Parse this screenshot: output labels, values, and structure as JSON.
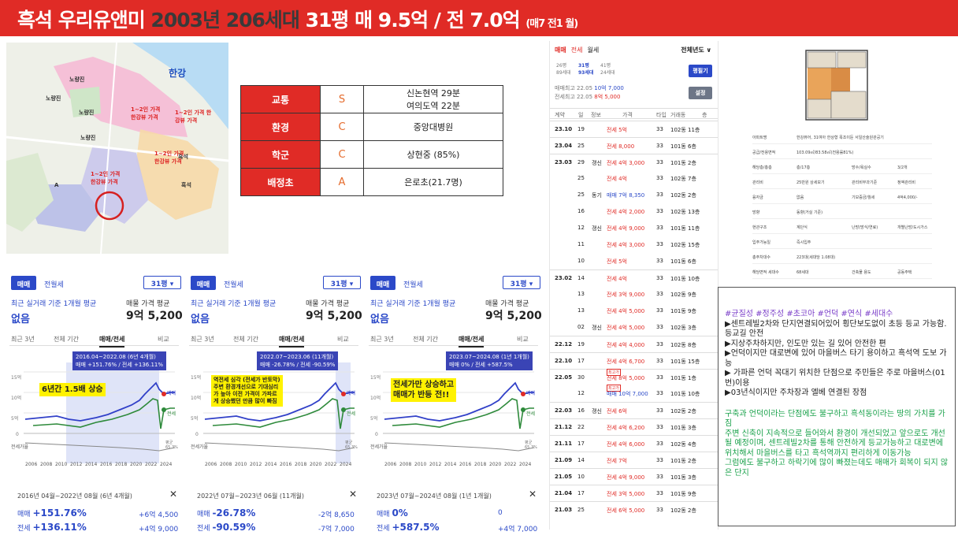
{
  "title": {
    "part1": "흑석 우리유앤미 ",
    "part2": "2003년 206세대 ",
    "part3": "31평 매 9.5억 / 전 7.0억",
    "small": "(매7 전1 월)"
  },
  "map": {
    "river": "한강",
    "labels": [
      "노량진",
      "노량진",
      "노량진",
      "노량진",
      "흑석",
      "흑석",
      "A",
      "1~2인 가격 한강뷰 가격",
      "1~2인 가격 한강뷰 가격",
      "1~2인 가격 한강뷰 가격",
      "1~2인 가격 한강뷰 가격"
    ]
  },
  "info": [
    {
      "key": "교통",
      "grade": "S",
      "value": "신논현역 29분\n여의도역 22분"
    },
    {
      "key": "환경",
      "grade": "C",
      "value": "중앙대병원"
    },
    {
      "key": "학군",
      "grade": "C",
      "value": "상현중 (85%)"
    },
    {
      "key": "배정초",
      "grade": "A",
      "value": "은로초(21.7명)"
    }
  ],
  "tx": {
    "tabs": [
      "매매",
      "전세",
      "월세"
    ],
    "year_select": "전체년도 ∨",
    "sizes": [
      "26평\n89세대",
      "31평\n93세대",
      "41평\n24세대"
    ],
    "btn1": "평필기",
    "hi1_label": "매매최고 22.05",
    "hi1_value": "10억 7,000",
    "hi2_label": "전세최고 22.05",
    "hi2_value": "8억 5,000",
    "btn2": "설정",
    "headers": [
      "계약",
      "일",
      "정보",
      "가격",
      "타입",
      "거래동",
      "층"
    ],
    "rows": [
      {
        "m": "23.10",
        "d": "19",
        "t": "",
        "p": "전세 5억",
        "f": "33",
        "b": "102동 11층",
        "c": "red"
      },
      {
        "m": "23.04",
        "d": "25",
        "t": "",
        "p": "전세 8,000",
        "f": "33",
        "b": "101동 6층",
        "c": "red"
      },
      {
        "m": "23.03",
        "d": "29",
        "t": "갱신",
        "p": "전세 4억 3,000",
        "f": "33",
        "b": "101동 2층",
        "c": "red"
      },
      {
        "m": "",
        "d": "25",
        "t": "",
        "p": "전세 4억",
        "f": "33",
        "b": "102동 7층",
        "c": "red"
      },
      {
        "m": "",
        "d": "25",
        "t": "동기",
        "p": "매매 7억 8,350",
        "f": "33",
        "b": "102동 2층",
        "c": "blue"
      },
      {
        "m": "",
        "d": "16",
        "t": "",
        "p": "전세 4억 2,000",
        "f": "33",
        "b": "102동 13층",
        "c": "red"
      },
      {
        "m": "",
        "d": "12",
        "t": "갱신",
        "p": "전세 4억 9,000",
        "f": "33",
        "b": "101동 11층",
        "c": "red"
      },
      {
        "m": "",
        "d": "11",
        "t": "",
        "p": "전세 4억 3,000",
        "f": "33",
        "b": "102동 15층",
        "c": "red"
      },
      {
        "m": "",
        "d": "10",
        "t": "",
        "p": "전세 5억",
        "f": "33",
        "b": "101동 6층",
        "c": "red"
      },
      {
        "m": "23.02",
        "d": "14",
        "t": "",
        "p": "전세 4억",
        "f": "33",
        "b": "101동 10층",
        "c": "red"
      },
      {
        "m": "",
        "d": "13",
        "t": "",
        "p": "전세 3억 9,000",
        "f": "33",
        "b": "102동 9층",
        "c": "red"
      },
      {
        "m": "",
        "d": "13",
        "t": "",
        "p": "전세 4억 5,000",
        "f": "33",
        "b": "101동 9층",
        "c": "red"
      },
      {
        "m": "",
        "d": "02",
        "t": "갱신",
        "p": "전세 4억 5,000",
        "f": "33",
        "b": "102동 3층",
        "c": "red"
      },
      {
        "m": "22.12",
        "d": "19",
        "t": "",
        "p": "전세 4억 4,000",
        "f": "33",
        "b": "102동 8층",
        "c": "red"
      },
      {
        "m": "22.10",
        "d": "17",
        "t": "",
        "p": "전세 4억 6,700",
        "f": "33",
        "b": "101동 15층",
        "c": "red"
      },
      {
        "m": "22.05",
        "d": "30",
        "t": "",
        "p": "전세 8억 5,000",
        "f": "33",
        "b": "101동 1층",
        "c": "red",
        "tag": "최고가"
      },
      {
        "m": "",
        "d": "12",
        "t": "",
        "p": "매매 10억 7,000",
        "f": "33",
        "b": "101동 10층",
        "c": "blue",
        "tag": "최고가"
      },
      {
        "m": "22.03",
        "d": "16",
        "t": "갱신",
        "p": "전세 6억",
        "f": "33",
        "b": "102동 2층",
        "c": "red"
      },
      {
        "m": "21.12",
        "d": "22",
        "t": "",
        "p": "전세 4억 6,200",
        "f": "33",
        "b": "101동 3층",
        "c": "red"
      },
      {
        "m": "21.11",
        "d": "17",
        "t": "",
        "p": "전세 4억 6,000",
        "f": "33",
        "b": "102동 4층",
        "c": "red"
      },
      {
        "m": "21.09",
        "d": "14",
        "t": "",
        "p": "전세 7억",
        "f": "33",
        "b": "101동 2층",
        "c": "red"
      },
      {
        "m": "21.05",
        "d": "10",
        "t": "",
        "p": "전세 4억 9,000",
        "f": "33",
        "b": "101동 3층",
        "c": "red"
      },
      {
        "m": "21.04",
        "d": "17",
        "t": "",
        "p": "전세 3억 5,000",
        "f": "33",
        "b": "101동 9층",
        "c": "red"
      },
      {
        "m": "21.03",
        "d": "25",
        "t": "",
        "p": "전세 6억 5,000",
        "f": "33",
        "b": "102동 2층",
        "c": "red"
      }
    ]
  },
  "details": [
    [
      "아파트명",
      "한강뷰어, 31여아 한상형 목조이둔 서일산술원관공기"
    ],
    [
      "공급/전용면적",
      "103.09㎡/83.58㎡(전용률81%)"
    ],
    [
      "해당층/총층",
      "층/17층",
      "방수/욕실수",
      "3/2개"
    ],
    [
      "관리비",
      "25만원 상세보기",
      "관리비부과기준",
      "정액관리비"
    ],
    [
      "융자금",
      "없음",
      "기보증금/월세",
      "4억4,000/-"
    ],
    [
      "방향",
      "동향(거실 기준)"
    ],
    [
      "현관구조",
      "계단식",
      "난방(방식/연료)",
      "개별난방/도시가스"
    ],
    [
      "입주가능일",
      "즉시입주"
    ],
    [
      "총주차대수",
      "223대(세대당 1.08대)"
    ],
    [
      "해당면적 세대수",
      "68세대",
      "건축물 용도",
      "공동주택"
    ]
  ],
  "panels": [
    {
      "tab_a": "매매",
      "tab_b": "전월세",
      "size": "31평 ▾",
      "sub": "최근 실거래 기준 1개월 평균",
      "none": "없음",
      "market_label": "매물 가격 평균",
      "market_value": "9억 5,200",
      "tabs": [
        "최근 3년",
        "전체 기간",
        "매매/전세",
        "비교"
      ],
      "callout1": "2016.04~2022.08 (6년 4개월)",
      "callout2": "매매 +151.76% / 전세 +136.11%",
      "note": "6년간 1.5배 상승",
      "range": "2016년 04월~2022년 08월 (6년 4개월)",
      "close": "✕",
      "r1_label": "매매",
      "r1_pct": "+151.76%",
      "r1_val": "+6억 4,500",
      "r2_label": "전세",
      "r2_pct": "+136.11%",
      "r2_val": "+4억 9,000",
      "years": [
        "2006",
        "2008",
        "2010",
        "2012",
        "2014",
        "2016",
        "2018",
        "2020",
        "2022",
        "2024"
      ]
    },
    {
      "tab_a": "매매",
      "tab_b": "전월세",
      "size": "31평 ▾",
      "sub": "최근 실거래 기준 1개월 평균",
      "none": "없음",
      "market_label": "매물 가격 평균",
      "market_value": "9억 5,200",
      "tabs": [
        "최근 3년",
        "전체 기간",
        "매매/전세",
        "비교"
      ],
      "callout1": "2022.07~2023.06 (11개월)",
      "callout2": "매매 -26.78% / 전세 -90.59%",
      "note": "역전세 심각 (전세가 반토막)\n주변 환경개선으로 기대심리\n가 높아 이전 가격이 가파르\n게 상승했던 만큼 많이 빠짐",
      "range": "2022년 07월~2023년 06월 (11개월)",
      "close": "✕",
      "r1_label": "매매",
      "r1_pct": "-26.78%",
      "r1_val": "-2억 8,650",
      "r2_label": "전세",
      "r2_pct": "-90.59%",
      "r2_val": "-7억 7,000",
      "years": [
        "2006",
        "2008",
        "2010",
        "2012",
        "2014",
        "2016",
        "2018",
        "2020",
        "2022",
        "2024"
      ]
    },
    {
      "tab_a": "매매",
      "tab_b": "전월세",
      "size": "31평 ▾",
      "sub": "최근 실거래 기준 1개월 평균",
      "none": "없음",
      "market_label": "매물 가격 평균",
      "market_value": "9억 5,200",
      "tabs": [
        "최근 3년",
        "전체 기간",
        "매매/전세",
        "비교"
      ],
      "callout1": "2023.07~2024.08 (1년 1개월)",
      "callout2": "매매 0% / 전세 +587.5%",
      "note": "전세가만 상승하고\n매매가 반등 전!!",
      "range": "2023년 07월~2024년 08월 (1년 1개월)",
      "close": "✕",
      "r1_label": "매매",
      "r1_pct": "0%",
      "r1_val": "0",
      "r2_label": "전세",
      "r2_pct": "+587.5%",
      "r2_val": "+4억 7,000",
      "years": [
        "2006",
        "2008",
        "2010",
        "2012",
        "2014",
        "2016",
        "2018",
        "2020",
        "2022",
        "2024"
      ]
    }
  ],
  "chart_axis": {
    "y_ticks": [
      "15억",
      "10억",
      "5억",
      "0"
    ],
    "legend_buy": "매매",
    "legend_rent": "전세",
    "legend_avg": "전세가율",
    "avg_val": "평균\n65.3%"
  },
  "summary": {
    "tags": "#균질성 #정주성 #초코아 #언덕 #연식 #세대수",
    "lines": [
      "▶센트레빌2차와 단지연결되어있어 횡단보도없이 초등 등교 가능함. 등교길 안전",
      "▶지상주차하지만, 인도만 있는 길 있어 안전한 편",
      "▶언덕이지만 대로변에 있어 마을버스 타기 용이하고 흑석역 도보 가능",
      "▶ 가파른 언덕 꼭대기 위치한 단점으로 주민들은 주로 마을버스(01번)이용",
      "▶03년식이지만 주차장과 엘베 연결된 장점"
    ],
    "green": [
      "구축과 언덕이라는 단점에도 불구하고 흑석동이라는 땅의 가치를 가짐",
      "주변 신축이 지속적으로 들어와서 환경이 개선되었고 앞으로도 개선될 예정이며, 센트레빌2차를 통해 안전하게 등교가능하고 대로변에 위치해서 마을버스를 타고 흑석역까지 편리하게 이동가능",
      "그럼에도 불구하고 하락기에 많이 빠졌는데도 매매가 회복이 되지 않은 단지"
    ]
  }
}
